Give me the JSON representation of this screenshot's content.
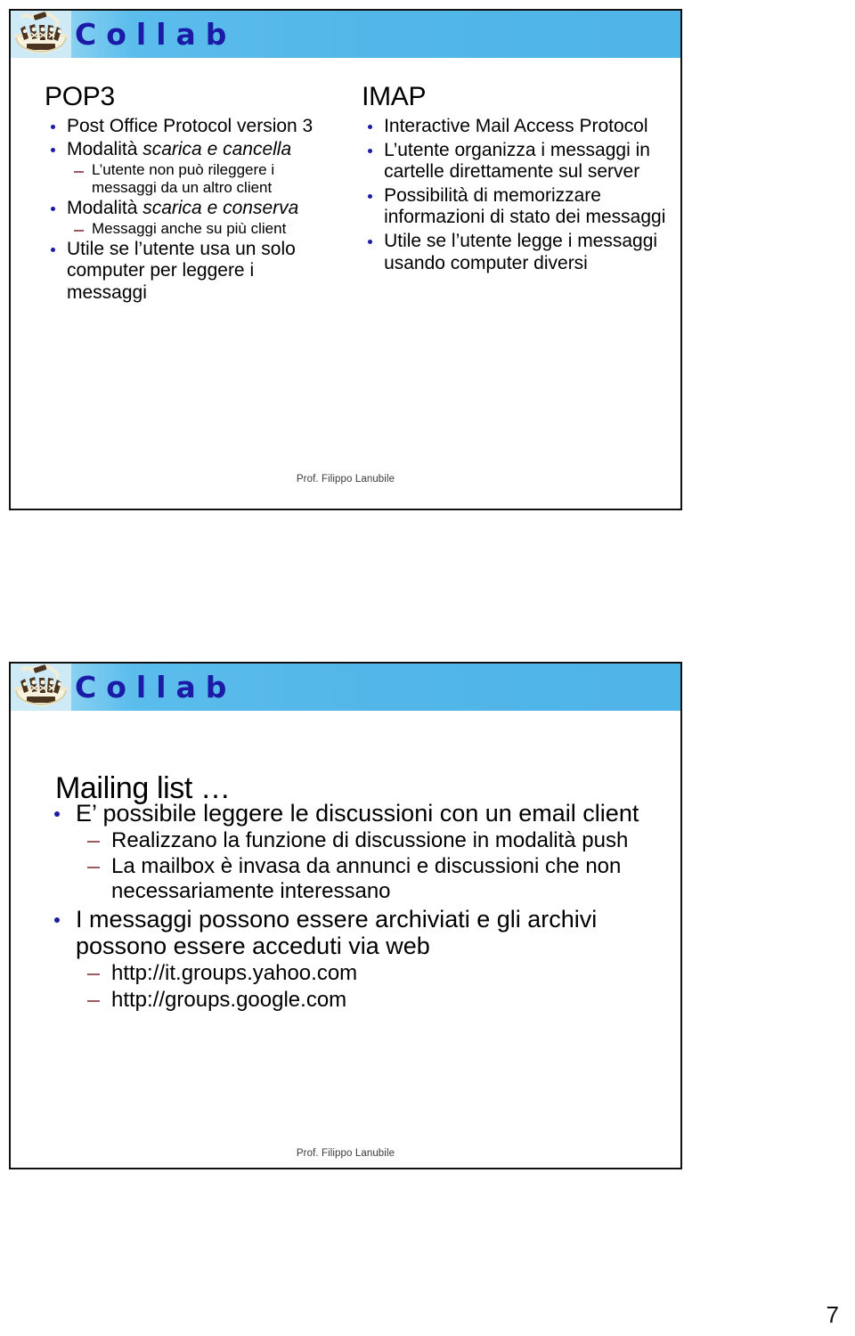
{
  "page": {
    "number": "7"
  },
  "brand": {
    "wordmark": "Collab",
    "wordmark_color": "#1b1ba8",
    "band_color": "#52b6e8",
    "logo_icon": "collab-people-bowl-logo"
  },
  "slide1": {
    "left": {
      "title": "POP3",
      "bullets": [
        {
          "text": "Post Office Protocol version 3",
          "sub": []
        },
        {
          "text_before": "Modalità ",
          "text_italic": "scarica e cancella",
          "sub": [
            "L’utente non può rileggere i messaggi da un altro client"
          ]
        },
        {
          "text_before": "Modalità ",
          "text_italic": "scarica e conserva",
          "sub": [
            "Messaggi anche su più client"
          ]
        },
        {
          "text": "Utile se l’utente usa un solo computer per leggere i messaggi",
          "sub": []
        }
      ]
    },
    "right": {
      "title": "IMAP",
      "bullets": [
        "Interactive Mail Access Protocol",
        "L’utente organizza i messaggi in cartelle direttamente sul server",
        "Possibilità di memorizzare informazioni di stato dei messaggi",
        "Utile se l’utente legge i messaggi usando computer diversi"
      ]
    },
    "footer": "Prof. Filippo Lanubile"
  },
  "slide2": {
    "title": "Mailing list …",
    "bullets": [
      {
        "text": "E’ possibile leggere le discussioni con un email client",
        "sub": [
          "Realizzano la funzione di discussione in modalità push",
          "La mailbox è invasa da annunci e discussioni che non necessariamente interessano"
        ]
      },
      {
        "text": "I messaggi possono essere archiviati e gli archivi possono essere acceduti via web",
        "sub": [
          "http://it.groups.yahoo.com",
          "http://groups.google.com"
        ]
      }
    ],
    "footer": "Prof. Filippo Lanubile"
  }
}
